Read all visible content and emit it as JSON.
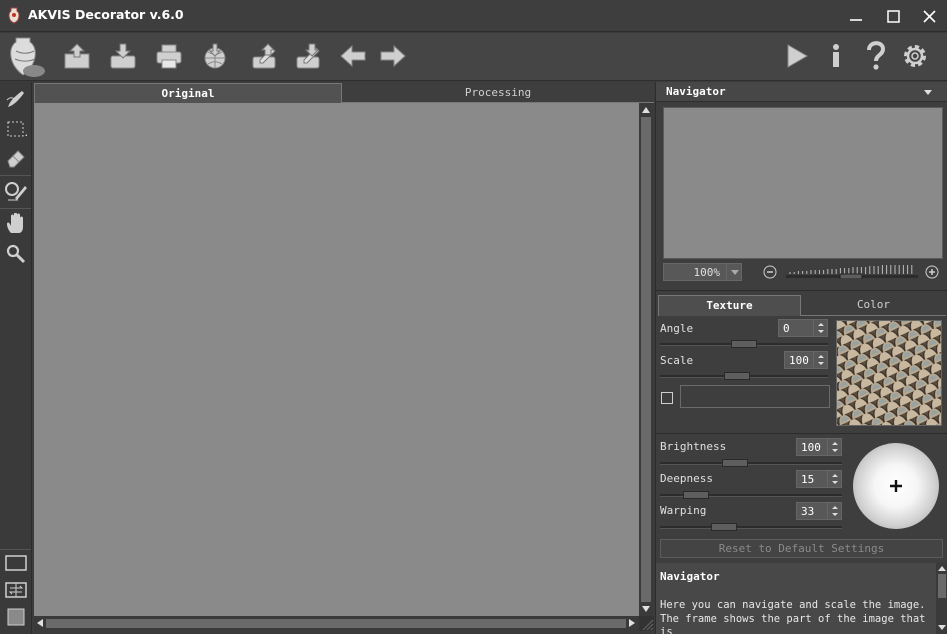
{
  "window": {
    "title": "AKVIS Decorator v.6.0",
    "controls": [
      "minimize",
      "maximize",
      "close"
    ]
  },
  "toolbar": {
    "left_icons": [
      "logo-vase-icon",
      "open-image-icon",
      "save-image-icon",
      "print-icon",
      "share-icon",
      "import-strokes-icon",
      "export-strokes-icon",
      "undo-arrow-icon",
      "redo-arrow-icon"
    ],
    "right_icons": [
      "run-play-icon",
      "info-icon",
      "help-icon",
      "settings-gear-icon"
    ]
  },
  "left_tools": [
    "decorator-brush-icon",
    "selection-rect-icon",
    "eraser-icon",
    "magic-tube-icon",
    "hand-icon",
    "zoom-icon"
  ],
  "left_tools_bottom": [
    "single-view-icon",
    "split-view-icon",
    "color-square-icon"
  ],
  "main_tabs": {
    "original": "Original",
    "processing": "Processing"
  },
  "navigator": {
    "title": "Navigator",
    "zoom": "100%"
  },
  "texture_tabs": {
    "texture": "Texture",
    "color": "Color"
  },
  "params": {
    "angle_label": "Angle",
    "angle_value": "0",
    "angle_level": 0.5,
    "scale_label": "Scale",
    "scale_value": "100",
    "scale_level": 0.45,
    "brightness_label": "Brightness",
    "brightness_value": "100",
    "brightness_level": 0.4,
    "deepness_label": "Deepness",
    "deepness_value": "15",
    "deepness_level": 0.15,
    "warping_label": "Warping",
    "warping_value": "33",
    "warping_level": 0.33
  },
  "reset_button": "Reset to Default Settings",
  "help": {
    "title": "Navigator",
    "text": "Here you can navigate and scale the image.\nThe frame shows the part of the image that is\nnow visible in the Image Window. Drag the"
  },
  "colors": {
    "canvas": "#8a8a8a",
    "panel": "#3e3e3e",
    "titlebar": "#3e3e3e"
  }
}
